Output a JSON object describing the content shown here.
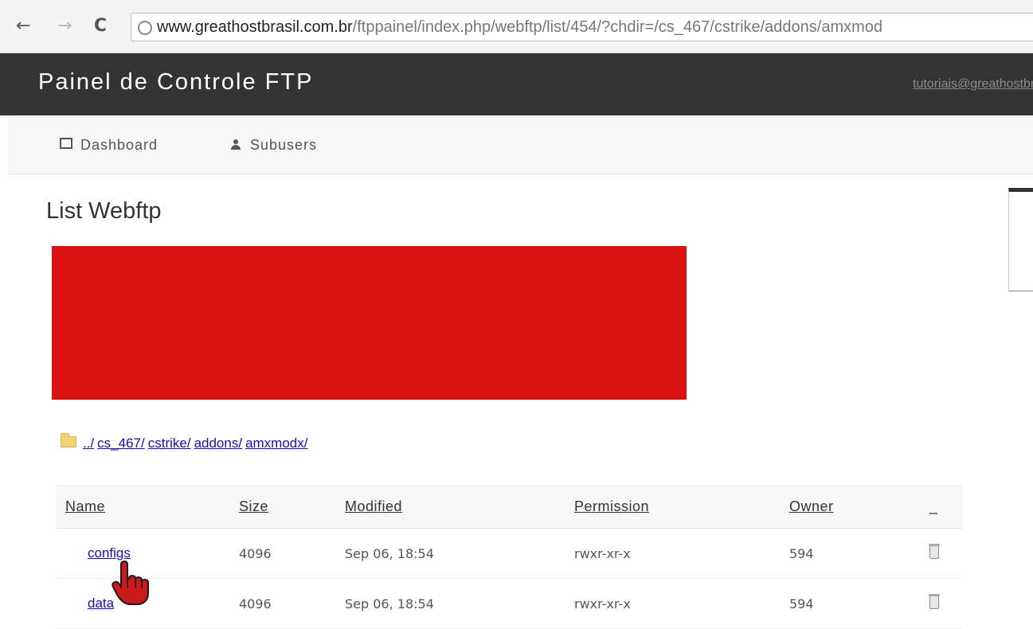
{
  "browser": {
    "url_host": "www.greathostbrasil.com.br",
    "url_path": "/ftppainel/index.php/webftp/list/454/?chdir=/cs_467/cstrike/addons/amxmod"
  },
  "header": {
    "title": "Painel de Controle FTP",
    "user_link": "tutoriais@greathostbrasil"
  },
  "nav": {
    "dashboard": "Dashboard",
    "subusers": "Subusers"
  },
  "page": {
    "title": "List Webftp"
  },
  "breadcrumb": [
    "../",
    "cs_467/",
    "cstrike/",
    "addons/",
    "amxmodx/"
  ],
  "table": {
    "headers": [
      "Name",
      "Size",
      "Modified",
      "Permission",
      "Owner",
      "_"
    ],
    "rows": [
      {
        "name": "configs",
        "size": "4096",
        "modified": "Sep 06, 18:54",
        "permission": "rwxr-xr-x",
        "owner": "594"
      },
      {
        "name": "data",
        "size": "4096",
        "modified": "Sep 06, 18:54",
        "permission": "rwxr-xr-x",
        "owner": "594"
      }
    ]
  },
  "colors": {
    "header_bg": "#333333",
    "redaction": "#db1212",
    "link": "#1a0dab"
  },
  "icons": [
    "back-icon",
    "forward-icon",
    "reload-icon",
    "globe-icon",
    "dashboard-icon",
    "user-icon",
    "folder-icon",
    "trash-icon",
    "hand-cursor-icon"
  ]
}
